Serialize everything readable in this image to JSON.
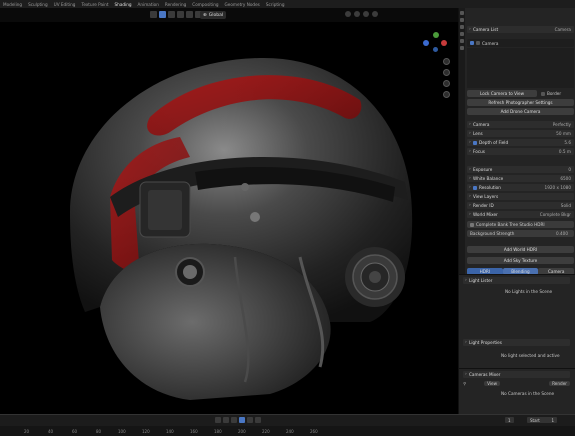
{
  "workspaces": [
    "Modeling",
    "Sculpting",
    "UV Editing",
    "Texture Paint",
    "Shading",
    "Animation",
    "Rendering",
    "Compositing",
    "Geometry Nodes",
    "Scripting"
  ],
  "active_workspace": "Shading",
  "viewport_header": {
    "transform_orientation": "Global"
  },
  "props": {
    "camera_list_title": "Camera List",
    "camera_tab": "Camera",
    "camera_item": "Camera",
    "lock_camera_to_view": "Lock Camera to View",
    "border": "Border",
    "refresh_photographer": "Refresh Photographer Settings",
    "add_drone_camera": "Add Drone Camera",
    "camera_section": "Camera",
    "camera_preset": "Perfectly",
    "lens": "Lens",
    "lens_value": "50 mm",
    "depth_of_field": "Depth of Field",
    "dof_value": "5.6",
    "focus": "Focus",
    "focus_value": "0.5 m",
    "exposure": "Exposure",
    "exposure_value": "0",
    "white_balance": "White Balance",
    "wb_value": "6500",
    "resolution": "Resolution",
    "resolution_value": "1920 x 1080",
    "view_layers": "View Layers",
    "render_settings_label": "Render ID",
    "render_settings_value": "Solid",
    "world_mixer": "World Mixer",
    "world_mixer_value": "Complete Bkgr",
    "hdri_name": "Complete Bank Tree Studio HDRI",
    "background_strength": "Background Strength",
    "background_strength_value": "0.400",
    "add_world_hdri": "Add World HDRI",
    "add_sky_texture": "Add Sky Texture",
    "tab_hdri": "HDRI",
    "tab_blend": "Blending",
    "tab_camera": "Camera"
  },
  "lights": {
    "title": "Light Lister",
    "no_lights": "No Lights in the Scene",
    "light_properties": "Light Properties",
    "no_light_selected": "No light selected and active"
  },
  "cameras_panel": {
    "title": "Cameras Mixer",
    "view_label": "View",
    "render_label": "Render",
    "no_cameras": "No Cameras in the Scene"
  },
  "timeline": {
    "current_frame": "1",
    "start_label": "Start",
    "start_frame": "1",
    "ticks": [
      "0",
      "20",
      "40",
      "60",
      "80",
      "100",
      "120",
      "140",
      "160",
      "180",
      "200",
      "220",
      "240",
      "260"
    ]
  }
}
